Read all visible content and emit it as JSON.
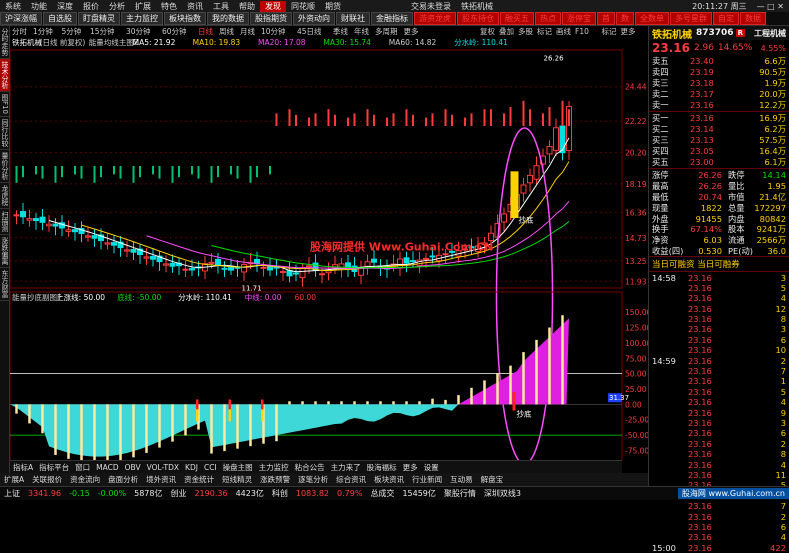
{
  "menubar": {
    "items": [
      "系统",
      "功能",
      "深度",
      "报价",
      "分析",
      "扩展",
      "特色",
      "资讯",
      "工具",
      "帮助"
    ],
    "highlight": "发现",
    "more": [
      "同花顺",
      "期货"
    ],
    "center": "交易未登录",
    "company": "铁拓机械",
    "clock": "20:11:27 周三"
  },
  "tabs": [
    "沪深涨幅",
    "自选股",
    "盯盘精灵",
    "主力监控",
    "板块指数",
    "我的数据",
    "股指期货",
    "外资动向",
    "财联社",
    "金融指标",
    "游资龙虎",
    "股东持仓",
    "融买五",
    "热点",
    "涨停宝",
    "首",
    "数",
    "全数单",
    "多号星群",
    "自定",
    "数据"
  ],
  "left_tabs": [
    "分时走势",
    "技术分析",
    "图F10",
    "同行比较",
    "量价分析",
    "龙虎榜",
    "扫描测",
    "涨跌偏离",
    "东方财富"
  ],
  "chart_header": {
    "periods": [
      "分时",
      "1分钟",
      "5分钟",
      "15分钟",
      "30分钟",
      "60分钟",
      "日线",
      "周线",
      "月线",
      "10分钟",
      "45日线",
      "季线",
      "年线",
      "多周期",
      "更多"
    ],
    "right": [
      "复权",
      "叠加",
      "多股",
      "标记",
      "画线",
      "F10",
      "标记",
      "更多"
    ]
  },
  "stock_line": {
    "name": "铁拓机械",
    "sub": "(日线 前复权)",
    "ind": "能量均线主图Z",
    "ma5": "MA5: 21.92",
    "ma10": "MA10: 19.83",
    "ma20": "MA20: 17.08",
    "ma30": "MA30: 15.74",
    "ma60": "MA60: 14.82",
    "fsx": "分水岭: 110.41"
  },
  "price_axis": [
    "24.44",
    "22.22",
    "20.20",
    "18.19",
    "16.36",
    "14.73",
    "13.25",
    "11.93"
  ],
  "annotations": {
    "high": "26.26",
    "low": "11.71",
    "buy_main": "抄底",
    "buy_sub": "抄底",
    "watermark": "股海网提供 Www.Guhai.Com.CN"
  },
  "sub_header": {
    "name": "能量抄底副图F",
    "line1": "上涨线: 50.00",
    "line2": "底线: -50.00",
    "line3": "分水岭: 110.41",
    "line4": "中线: 0.00",
    "line5": "60.00"
  },
  "sub_axis": [
    "150.00",
    "125.00",
    "100.00",
    "75.00",
    "50.00",
    "25.00",
    "0.00",
    "-25.00",
    "-50.00",
    "-75.00",
    "-100.00"
  ],
  "sub_right_tag": "31.37",
  "x_labels": {
    "left": "2024年",
    "mid": "2024/12/31/二",
    "right": "日线"
  },
  "quote": {
    "title": "铁拓机械",
    "code": "873706",
    "badge": "R",
    "price": "23.16",
    "change": "2.96",
    "pct": "14.65%",
    "side_label": "工程机械",
    "side_pct": "4.55%",
    "asks": [
      {
        "l": "卖五",
        "p": "23.40",
        "v": "6.6万"
      },
      {
        "l": "卖四",
        "p": "23.19",
        "v": "90.5万"
      },
      {
        "l": "卖三",
        "p": "23.18",
        "v": "1.9万"
      },
      {
        "l": "卖二",
        "p": "23.17",
        "v": "20.0万"
      },
      {
        "l": "卖一",
        "p": "23.16",
        "v": "12.2万"
      }
    ],
    "bids": [
      {
        "l": "买一",
        "p": "23.16",
        "v": "16.9万"
      },
      {
        "l": "买二",
        "p": "23.14",
        "v": "6.2万"
      },
      {
        "l": "买三",
        "p": "23.13",
        "v": "57.5万"
      },
      {
        "l": "买四",
        "p": "23.05",
        "v": "16.4万"
      },
      {
        "l": "买五",
        "p": "23.00",
        "v": "6.1万"
      }
    ],
    "stats": [
      {
        "a": "涨停",
        "b": "26.26",
        "c": "跌停",
        "d": "14.14"
      },
      {
        "a": "最高",
        "b": "26.26",
        "c": "量比",
        "d": "1.95"
      },
      {
        "a": "最低",
        "b": "20.74",
        "c": "市值",
        "d": "21.4亿"
      },
      {
        "a": "现量",
        "b": "1822",
        "c": "总量",
        "d": "172297"
      },
      {
        "a": "外盘",
        "b": "91455",
        "c": "内盘",
        "d": "80842"
      },
      {
        "a": "换手",
        "b": "67.14%",
        "c": "股本",
        "d": "9241万"
      },
      {
        "a": "净资",
        "b": "6.03",
        "c": "流通",
        "d": "2566万"
      },
      {
        "a": "收益(四)",
        "b": "0.530",
        "c": "PE(动)",
        "d": "36.0"
      }
    ],
    "margin": "当日可融资 当日可融券",
    "ticks": [
      [
        "14:58",
        "23.16",
        "3"
      ],
      [
        "",
        "23.16",
        "5"
      ],
      [
        "",
        "23.16",
        "4"
      ],
      [
        "",
        "23.16",
        "12"
      ],
      [
        "",
        "23.16",
        "8"
      ],
      [
        "",
        "23.16",
        "3"
      ],
      [
        "",
        "23.16",
        "6"
      ],
      [
        "",
        "23.16",
        "10"
      ],
      [
        "14:59",
        "23.16",
        "2"
      ],
      [
        "",
        "23.16",
        "7"
      ],
      [
        "",
        "23.16",
        "1"
      ],
      [
        "",
        "23.16",
        "5"
      ],
      [
        "",
        "23.16",
        "4"
      ],
      [
        "",
        "23.16",
        "9"
      ],
      [
        "",
        "23.16",
        "3"
      ],
      [
        "",
        "23.16",
        "6"
      ],
      [
        "",
        "23.16",
        "2"
      ],
      [
        "",
        "23.16",
        "8"
      ],
      [
        "",
        "23.16",
        "4"
      ],
      [
        "",
        "23.16",
        "11"
      ],
      [
        "",
        "23.16",
        "5"
      ],
      [
        "",
        "23.16",
        "3"
      ],
      [
        "",
        "23.16",
        "7"
      ],
      [
        "",
        "23.16",
        "2"
      ],
      [
        "",
        "23.16",
        "6"
      ],
      [
        "",
        "23.16",
        "4"
      ],
      [
        "15:00",
        "23.16",
        "422"
      ]
    ]
  },
  "bottom_tabs": [
    "指标A",
    "指标平台",
    "窗口",
    "MACD",
    "OBV",
    "VOL-TDX",
    "KDJ",
    "CCI",
    "操盘主图",
    "主力监控",
    "粘合公告",
    "主力来了",
    "股海福标",
    "更多",
    "设置"
  ],
  "bottom_tabs2": [
    "扩展A",
    "关联报价",
    "资金流向",
    "盘面分析",
    "境外资讯",
    "资金统计",
    "短线精灵",
    "涨跌预警",
    "逐笔分析",
    "综合资讯",
    "板块资讯",
    "行业新闻",
    "互动易",
    "解盘宝"
  ],
  "statusbar": [
    {
      "l": "上证",
      "v": "3341.96",
      "c": "red"
    },
    {
      "v": "-0.15",
      "c": "green"
    },
    {
      "v": "-0.00%",
      "c": "green"
    },
    {
      "v": "5878亿",
      "c": "white"
    },
    {
      "l": "创业",
      "v": "2190.36",
      "c": "red"
    },
    {
      "v": "4423亿",
      "c": "white"
    },
    {
      "l": "科创",
      "v": "1083.82",
      "c": "red"
    },
    {
      "v": "0.79%",
      "c": "red"
    },
    {
      "l": "总成交",
      "v": "15459亿",
      "c": "white"
    },
    {
      "l": "",
      "v": "聚股行情",
      "c": "white"
    },
    {
      "l": "",
      "v": "深圳双线3",
      "c": "white"
    }
  ],
  "logo": "股海网 www.Guhai.com.cn"
}
